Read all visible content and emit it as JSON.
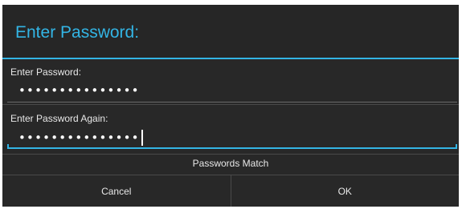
{
  "dialog": {
    "title": "Enter Password:",
    "field1": {
      "label": "Enter Password:",
      "value": "•••••••••••••••"
    },
    "field2": {
      "label": "Enter Password Again:",
      "value": "•••••••••••••••"
    },
    "status": "Passwords Match",
    "buttons": {
      "cancel": "Cancel",
      "ok": "OK"
    }
  },
  "colors": {
    "accent": "#33b5e5",
    "background": "#282828",
    "text": "#e8e8e8"
  }
}
